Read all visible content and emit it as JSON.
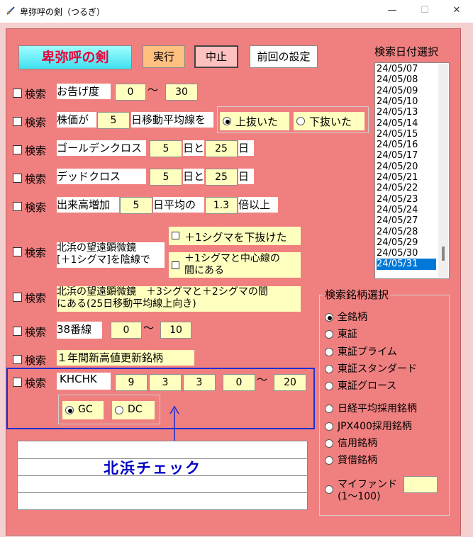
{
  "window": {
    "title": "卑弥呼の剣（つるぎ）",
    "min": "—",
    "max": "☐",
    "close": "✕"
  },
  "toolbar": {
    "app_name": "卑弥呼の剣",
    "run": "実行",
    "stop": "中止",
    "prev": "前回の設定"
  },
  "search_label": "検索",
  "rows": {
    "r1": {
      "text": "お告げ度",
      "v1": "0",
      "sep": "〜",
      "v2": "30"
    },
    "r2": {
      "pre": "株価が",
      "v1": "5",
      "mid": "日移動平均線を",
      "opt_up": "上抜いた",
      "opt_down": "下抜いた"
    },
    "r3": {
      "text": "ゴールデンクロス",
      "v1": "5",
      "mid": "日と",
      "v2": "25",
      "post": "日"
    },
    "r4": {
      "text": "デッドクロス",
      "v1": "5",
      "mid": "日と",
      "v2": "25",
      "post": "日"
    },
    "r5": {
      "pre": "出来高増加",
      "v1": "5",
      "mid": "日平均の",
      "v2": "1.3",
      "post": "倍以上"
    },
    "r6": {
      "line1": "北浜の望遠顕微鏡",
      "line2": "[＋1シグマ]を陰線で",
      "opt1": "＋1シグマを下抜けた",
      "opt2a": "＋1シグマと中心線の",
      "opt2b": "間にある"
    },
    "r7": {
      "line1": "北浜の望遠顕微鏡　＋3シグマと＋2シグマの間",
      "line2": "にある(25日移動平均線上向き)"
    },
    "r8": {
      "text": "38番線",
      "v1": "0",
      "sep": "〜",
      "v2": "10"
    },
    "r9": {
      "text": "１年間新高値更新銘柄"
    },
    "r10": {
      "text": "KHCHK",
      "v1": "9",
      "v2": "3",
      "v3": "3",
      "v4": "0",
      "sep": "〜",
      "v5": "20",
      "gc": "GC",
      "dc": "DC"
    }
  },
  "annotation": {
    "label": "北浜チェック",
    "arrow": "↑"
  },
  "date_list": {
    "title": "検索日付選択",
    "items": [
      "24/05/07",
      "24/05/08",
      "24/05/09",
      "24/05/10",
      "24/05/13",
      "24/05/14",
      "24/05/15",
      "24/05/16",
      "24/05/17",
      "24/05/20",
      "24/05/21",
      "24/05/22",
      "24/05/23",
      "24/05/24",
      "24/05/27",
      "24/05/28",
      "24/05/29",
      "24/05/30",
      "24/05/31"
    ],
    "selected": "24/05/31"
  },
  "stock_group": {
    "title": "検索銘柄選択",
    "options": [
      "全銘柄",
      "東証",
      "東証プライム",
      "東証スタンダード",
      "東証グロース",
      "日経平均採用銘柄",
      "JPX400採用銘柄",
      "信用銘柄",
      "貸借銘柄"
    ],
    "myfund_line1": "マイファンド",
    "myfund_line2": "(1〜100)",
    "myfund_value": ""
  },
  "colors": {
    "panel": "#f08080",
    "field": "#ffffc0",
    "selection": "#0078d7",
    "title_red": "#e8003a",
    "annot_blue": "#0000c8",
    "box_blue": "#2030d0"
  }
}
